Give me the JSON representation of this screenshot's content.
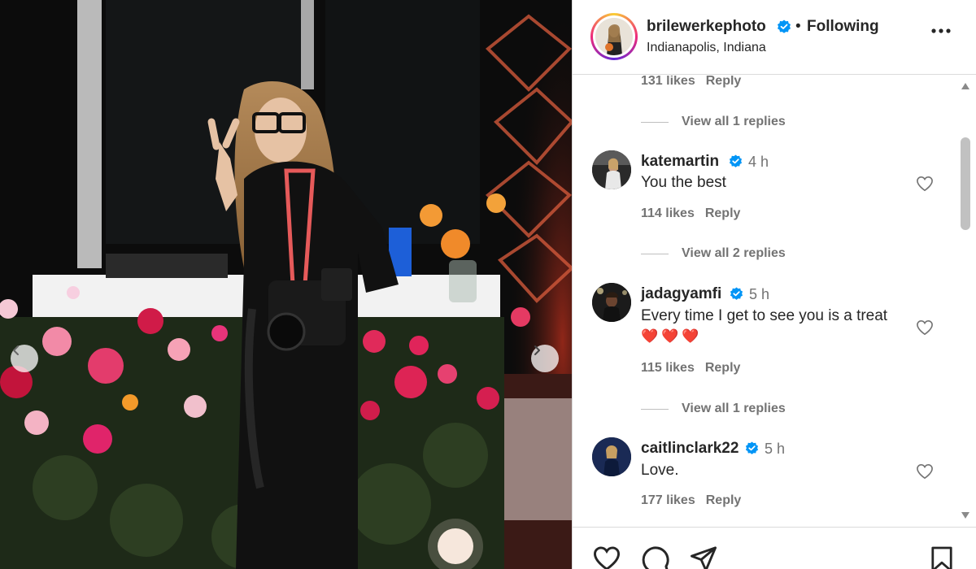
{
  "header": {
    "username": "brilewerkephoto",
    "separator": "•",
    "follow_status": "Following",
    "location": "Indianapolis, Indiana"
  },
  "comments": [
    {
      "likes": "131 likes",
      "reply": "Reply",
      "view_replies": "View all 1 replies"
    },
    {
      "username": "katemartin",
      "time": "4 h",
      "text": "You the best",
      "likes": "114 likes",
      "reply": "Reply",
      "view_replies": "View all 2 replies"
    },
    {
      "username": "jadagyamfi",
      "time": "5 h",
      "text": "Every time I get to see you is a treat",
      "emoji": "❤️❤️❤️",
      "likes": "115 likes",
      "reply": "Reply",
      "view_replies": "View all 1 replies"
    },
    {
      "username": "caitlinclark22",
      "time": "5 h",
      "text": "Love.",
      "likes": "177 likes",
      "reply": "Reply"
    }
  ],
  "icons": {
    "verified": "verified-badge-icon",
    "more": "more-options-icon",
    "heart": "heart-icon",
    "comment": "comment-icon",
    "share": "share-icon",
    "save": "bookmark-icon",
    "prev": "chevron-left-icon",
    "next": "chevron-right-icon"
  },
  "colors": {
    "verified_blue": "#0095f6",
    "text": "#262626",
    "muted": "#737373",
    "heart_red": "#e0212f"
  }
}
